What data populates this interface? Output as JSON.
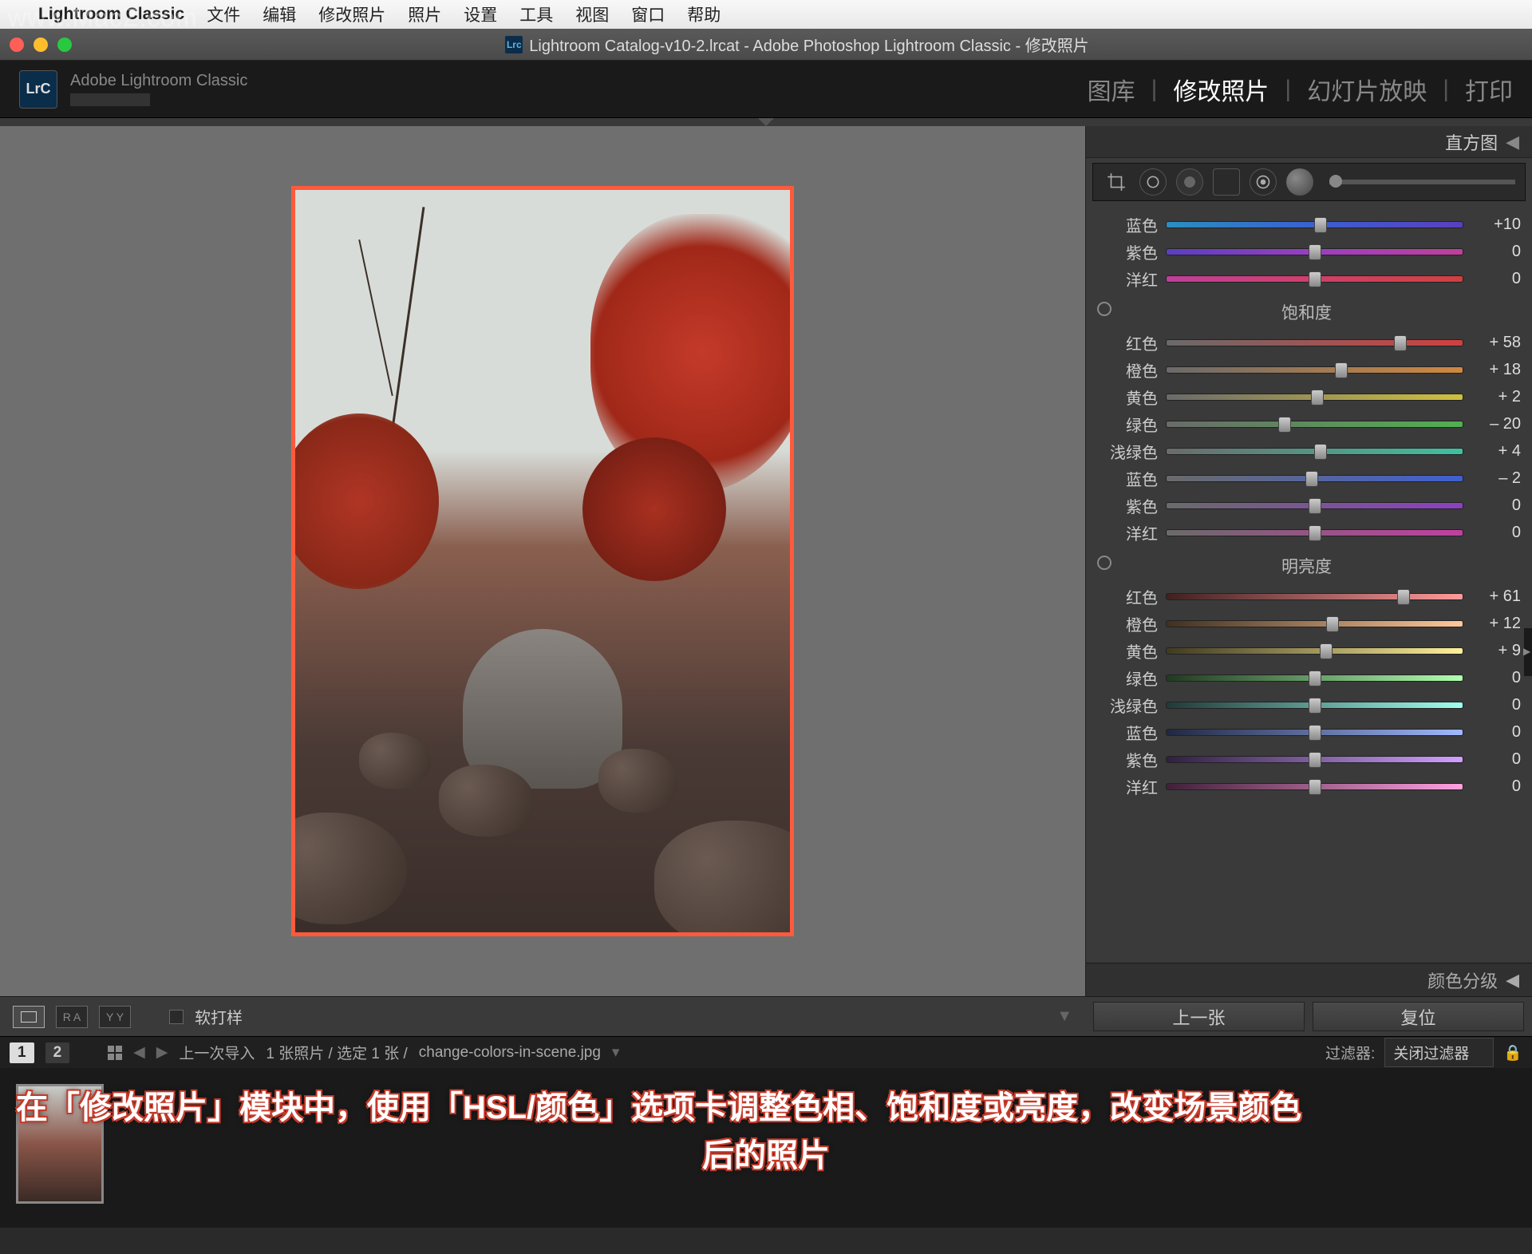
{
  "watermark": "www.MacZ.com",
  "menubar": {
    "apple": "",
    "appname": "Lightroom Classic",
    "items": [
      "文件",
      "编辑",
      "修改照片",
      "照片",
      "设置",
      "工具",
      "视图",
      "窗口",
      "帮助"
    ]
  },
  "titlebar": {
    "icon": "Lrc",
    "title": "Lightroom Catalog-v10-2.lrcat - Adobe Photoshop Lightroom Classic - 修改照片"
  },
  "identity": {
    "logo": "LrC",
    "name": "Adobe Lightroom Classic"
  },
  "modules": {
    "library": "图库",
    "develop": "修改照片",
    "slideshow": "幻灯片放映",
    "print": "打印",
    "sep": "|"
  },
  "panel": {
    "histogram": "直方图",
    "color_grading": "颜色分级",
    "triangle": "◀"
  },
  "hue_tail": {
    "rows": [
      {
        "label": "蓝色",
        "value": "+10",
        "pos": 52,
        "grad": "linear-gradient(90deg,#2a8fbf,#3a5fd0,#5a3fc0)"
      },
      {
        "label": "紫色",
        "value": "0",
        "pos": 50,
        "grad": "linear-gradient(90deg,#5a3fc0,#9a3fc0,#c03f9a)"
      },
      {
        "label": "洋红",
        "value": "0",
        "pos": 50,
        "grad": "linear-gradient(90deg,#c03f9a,#d03f6a,#d04040)"
      }
    ]
  },
  "saturation": {
    "title": "饱和度",
    "rows": [
      {
        "label": "红色",
        "value": "+ 58",
        "pos": 79,
        "grad": "linear-gradient(90deg,#6a6a6a,#d04040)"
      },
      {
        "label": "橙色",
        "value": "+ 18",
        "pos": 59,
        "grad": "linear-gradient(90deg,#6a6a6a,#d08840)"
      },
      {
        "label": "黄色",
        "value": "+ 2",
        "pos": 51,
        "grad": "linear-gradient(90deg,#6a6a6a,#d0c040)"
      },
      {
        "label": "绿色",
        "value": "– 20",
        "pos": 40,
        "grad": "linear-gradient(90deg,#6a6a6a,#50b050)"
      },
      {
        "label": "浅绿色",
        "value": "+ 4",
        "pos": 52,
        "grad": "linear-gradient(90deg,#6a6a6a,#40c0a0)"
      },
      {
        "label": "蓝色",
        "value": "– 2",
        "pos": 49,
        "grad": "linear-gradient(90deg,#6a6a6a,#4060d0)"
      },
      {
        "label": "紫色",
        "value": "0",
        "pos": 50,
        "grad": "linear-gradient(90deg,#6a6a6a,#8a40c0)"
      },
      {
        "label": "洋红",
        "value": "0",
        "pos": 50,
        "grad": "linear-gradient(90deg,#6a6a6a,#c040a0)"
      }
    ]
  },
  "luminance": {
    "title": "明亮度",
    "rows": [
      {
        "label": "红色",
        "value": "+ 61",
        "pos": 80,
        "grad": "linear-gradient(90deg,#402020,#ff9a9a)"
      },
      {
        "label": "橙色",
        "value": "+ 12",
        "pos": 56,
        "grad": "linear-gradient(90deg,#403020,#ffc89a)"
      },
      {
        "label": "黄色",
        "value": "+ 9",
        "pos": 54,
        "grad": "linear-gradient(90deg,#403a20,#fff09a)"
      },
      {
        "label": "绿色",
        "value": "0",
        "pos": 50,
        "grad": "linear-gradient(90deg,#203a20,#b0ffb0)"
      },
      {
        "label": "浅绿色",
        "value": "0",
        "pos": 50,
        "grad": "linear-gradient(90deg,#203a38,#a0fff0)"
      },
      {
        "label": "蓝色",
        "value": "0",
        "pos": 50,
        "grad": "linear-gradient(90deg,#202840,#a0b8ff)"
      },
      {
        "label": "紫色",
        "value": "0",
        "pos": 50,
        "grad": "linear-gradient(90deg,#302040,#d0a0ff)"
      },
      {
        "label": "洋红",
        "value": "0",
        "pos": 50,
        "grad": "linear-gradient(90deg,#402038,#ffa0e0)"
      }
    ]
  },
  "bottom": {
    "soft_proof": "软打样",
    "prev": "上一张",
    "reset": "复位",
    "ra": "R A",
    "yy": "Y Y"
  },
  "filmstrip": {
    "badge1": "1",
    "badge2": "2",
    "last_import": "上一次导入",
    "count": "1 张照片 / 选定 1 张 /",
    "filename": "change-colors-in-scene.jpg",
    "filter_label": "过滤器:",
    "filter_value": "关闭过滤器"
  },
  "caption": {
    "line1": "在「修改照片」模块中，使用「HSL/颜色」选项卡调整色相、饱和度或亮度，改变场景颜色",
    "line2": "后的照片"
  }
}
